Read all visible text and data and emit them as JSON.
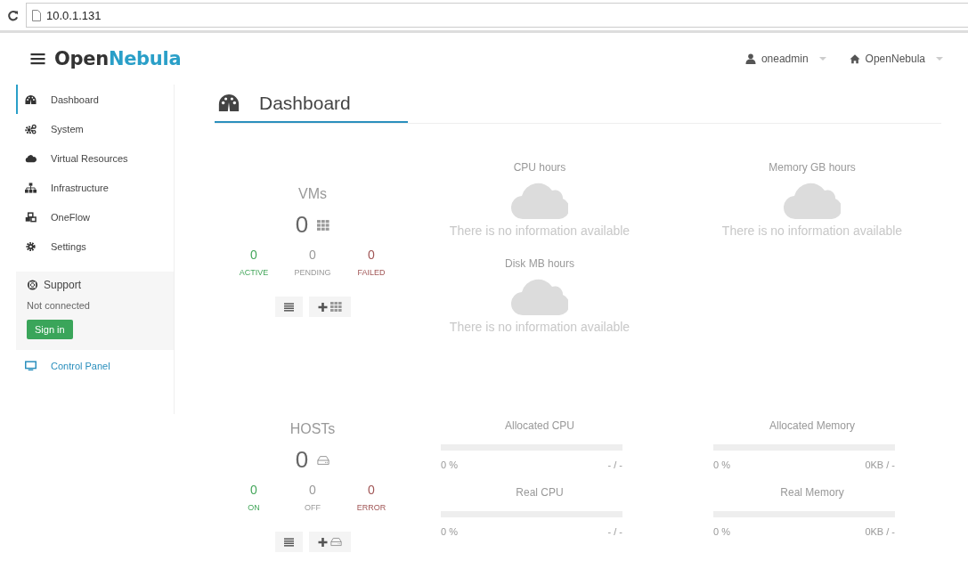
{
  "browser": {
    "url": "10.0.1.131"
  },
  "header": {
    "logo": "Open",
    "logo_accent": "Nebula",
    "user": "oneadmin",
    "zone": "OpenNebula"
  },
  "sidebar": {
    "items": [
      {
        "label": "Dashboard",
        "selected": true
      },
      {
        "label": "System",
        "selected": false
      },
      {
        "label": "Virtual Resources",
        "selected": false
      },
      {
        "label": "Infrastructure",
        "selected": false
      },
      {
        "label": "OneFlow",
        "selected": false
      },
      {
        "label": "Settings",
        "selected": false
      }
    ],
    "support": {
      "title": "Support",
      "status": "Not connected",
      "button": "Sign in"
    },
    "control_panel": "Control Panel"
  },
  "page": {
    "title": "Dashboard"
  },
  "vms": {
    "title": "VMs",
    "count": "0",
    "stats": [
      {
        "value": "0",
        "label": "ACTIVE",
        "kind": "good"
      },
      {
        "value": "0",
        "label": "PENDING",
        "kind": "neutral"
      },
      {
        "value": "0",
        "label": "FAILED",
        "kind": "bad"
      }
    ]
  },
  "accounting": [
    {
      "title": "CPU hours",
      "message": "There is no information available"
    },
    {
      "title": "Memory GB hours",
      "message": "There is no information available"
    },
    {
      "title": "Disk MB hours",
      "message": "There is no information available"
    }
  ],
  "hosts": {
    "title": "HOSTs",
    "count": "0",
    "stats": [
      {
        "value": "0",
        "label": "ON",
        "kind": "good"
      },
      {
        "value": "0",
        "label": "OFF",
        "kind": "neutral"
      },
      {
        "value": "0",
        "label": "ERROR",
        "kind": "bad"
      }
    ]
  },
  "meters": [
    {
      "title": "Allocated CPU",
      "level": 0,
      "percent": "0 %",
      "reading": "- / -"
    },
    {
      "title": "Allocated Memory",
      "level": 0,
      "percent": "0 %",
      "reading": "0KB / -"
    },
    {
      "title": "Real CPU",
      "level": 0,
      "percent": "0 %",
      "reading": "- / -"
    },
    {
      "title": "Real Memory",
      "level": 0,
      "percent": "0 %",
      "reading": "0KB / -"
    }
  ]
}
